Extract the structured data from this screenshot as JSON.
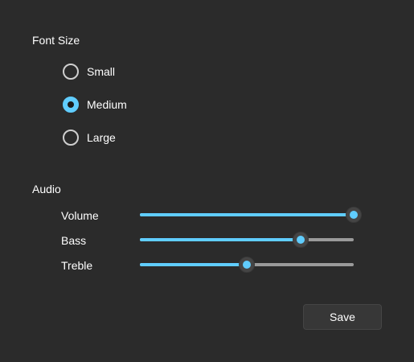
{
  "font_size": {
    "title": "Font Size",
    "options": [
      {
        "label": "Small",
        "selected": false
      },
      {
        "label": "Medium",
        "selected": true
      },
      {
        "label": "Large",
        "selected": false
      }
    ]
  },
  "audio": {
    "title": "Audio",
    "sliders": [
      {
        "label": "Volume",
        "value": 100
      },
      {
        "label": "Bass",
        "value": 75
      },
      {
        "label": "Treble",
        "value": 50
      }
    ]
  },
  "actions": {
    "save_label": "Save"
  },
  "colors": {
    "accent": "#60cdff",
    "background": "#2b2b2b",
    "track": "#9a9a9a"
  }
}
